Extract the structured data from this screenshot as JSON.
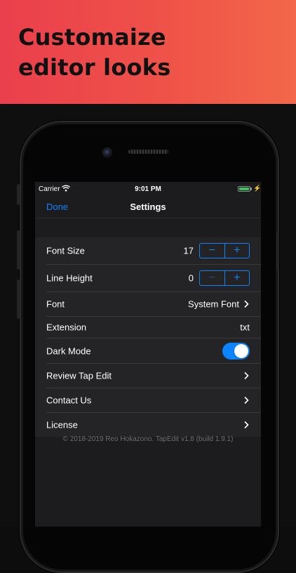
{
  "promo": {
    "headline_line1": "Customaize",
    "headline_line2": "editor looks"
  },
  "status_bar": {
    "carrier": "Carrier",
    "time": "9:01 PM",
    "battery_level": 1.0
  },
  "nav": {
    "done_label": "Done",
    "title": "Settings"
  },
  "settings": {
    "font_size": {
      "label": "Font Size",
      "value": "17",
      "minus": "−",
      "plus": "+"
    },
    "line_height": {
      "label": "Line Height",
      "value": "0",
      "minus": "−",
      "plus": "+"
    },
    "font": {
      "label": "Font",
      "value": "System Font"
    },
    "extension": {
      "label": "Extension",
      "value": "txt"
    },
    "dark_mode": {
      "label": "Dark Mode",
      "on": true
    },
    "review": {
      "label": "Review Tap Edit"
    },
    "contact": {
      "label": "Contact Us"
    },
    "license": {
      "label": "License"
    }
  },
  "footer": {
    "text": "© 2018-2019 Reo Hokazono. TapEdit v1.8 (build 1.9.1)"
  },
  "colors": {
    "accent": "#0a84ff",
    "promo_start": "#ea3f4d",
    "promo_end": "#f3674a",
    "battery": "#34c759"
  }
}
